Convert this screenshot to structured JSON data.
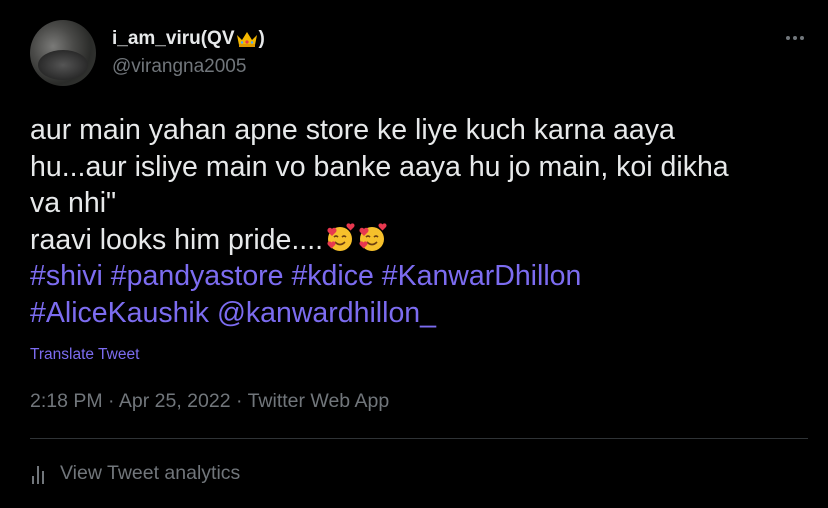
{
  "author": {
    "display_name_prefix": "i_am_viru(QV",
    "display_name_suffix": ")",
    "handle": "@virangna2005",
    "crown_icon": "crown-emoji"
  },
  "tweet": {
    "line1": "aur main yahan apne store ke liye kuch karna aaya",
    "line2": "hu...aur isliye main vo banke aaya hu jo main, koi dikha",
    "line3": "va nhi\"",
    "line4": "raavi looks him pride....",
    "hashtags_line1": [
      "#shivi",
      "#pandyastore",
      "#kdice",
      "#KanwarDhillon"
    ],
    "hashtags_line2": [
      "#AliceKaushik"
    ],
    "mention": "@kanwardhillon_",
    "emoji": "smiling-face-with-hearts"
  },
  "translate_label": "Translate Tweet",
  "meta": {
    "time": "2:18 PM",
    "date": "Apr 25, 2022",
    "source": "Twitter Web App",
    "separator": "·"
  },
  "analytics_label": "View Tweet analytics",
  "colors": {
    "background": "#000000",
    "text": "#e7e9ea",
    "muted": "#71767b",
    "link": "#7c6cf0",
    "divider": "#2f3336"
  }
}
